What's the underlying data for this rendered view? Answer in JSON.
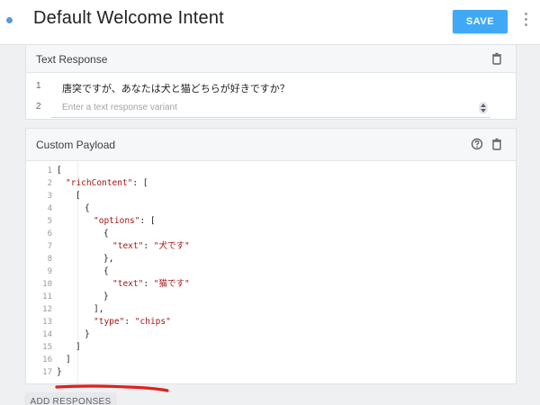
{
  "header": {
    "title": "Default Welcome Intent",
    "save_label": "SAVE"
  },
  "text_response": {
    "title": "Text Response",
    "rows": [
      {
        "num": "1",
        "text": "唐突ですが、あなたは犬と猫どちらが好きですか？"
      },
      {
        "num": "2",
        "placeholder": "Enter a text response variant"
      }
    ]
  },
  "custom_payload": {
    "title": "Custom Payload",
    "line_numbers": [
      "1",
      "2",
      "3",
      "4",
      "5",
      "6",
      "7",
      "8",
      "9",
      "10",
      "11",
      "12",
      "13",
      "14",
      "15",
      "16",
      "17"
    ]
  },
  "add_responses_label": "ADD RESPONSES",
  "colors": {
    "accent": "#3fa9f5",
    "code_string": "#a31515",
    "underline": "#e0201c"
  }
}
